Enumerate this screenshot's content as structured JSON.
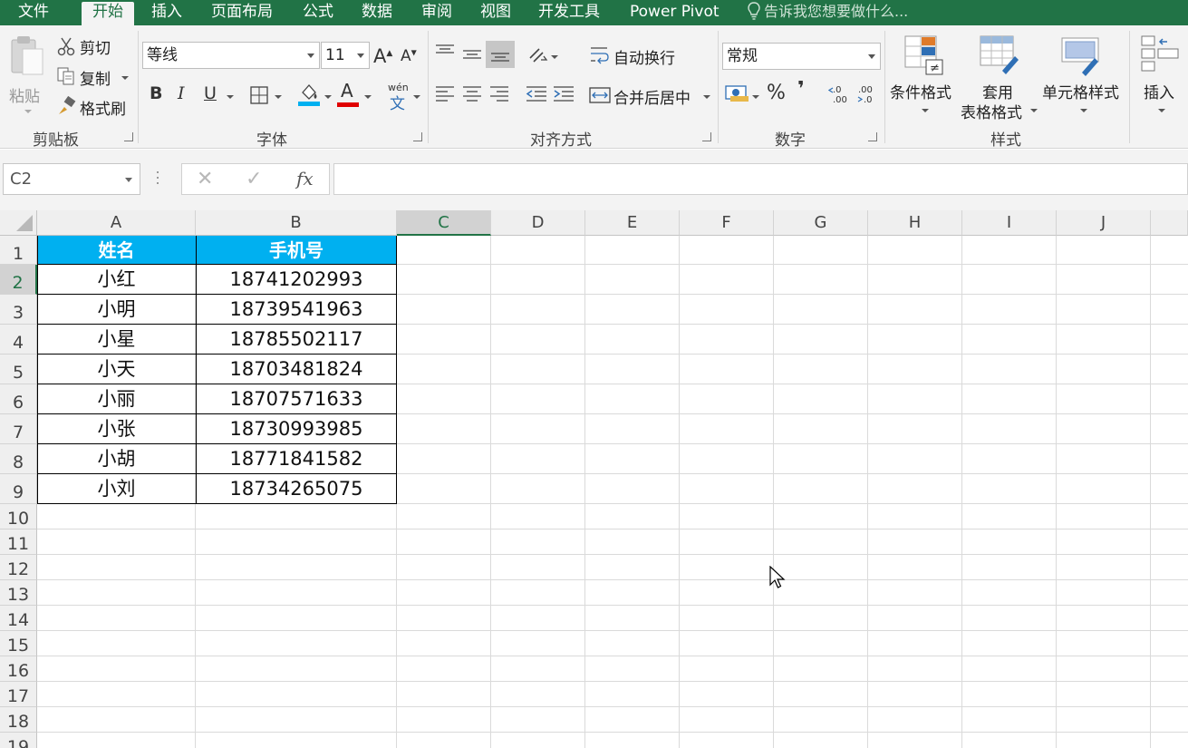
{
  "menu": {
    "tabs": [
      {
        "label": "文件"
      },
      {
        "label": "开始"
      },
      {
        "label": "插入"
      },
      {
        "label": "页面布局"
      },
      {
        "label": "公式"
      },
      {
        "label": "数据"
      },
      {
        "label": "审阅"
      },
      {
        "label": "视图"
      },
      {
        "label": "开发工具"
      },
      {
        "label": "Power Pivot"
      }
    ],
    "active_tab": "开始",
    "tell_me": "告诉我您想要做什么..."
  },
  "ribbon": {
    "clipboard": {
      "paste": "粘贴",
      "cut": "剪切",
      "copy": "复制",
      "format_painter": "格式刷",
      "group_label": "剪贴板"
    },
    "font": {
      "font_name": "等线",
      "font_size": "11",
      "bold": "B",
      "italic": "I",
      "underline": "U",
      "font_color_glyph": "A",
      "phonetic_top": "wén",
      "phonetic_bottom": "文",
      "group_label": "字体"
    },
    "alignment": {
      "wrap_text": "自动换行",
      "merge_center": "合并后居中",
      "group_label": "对齐方式"
    },
    "number": {
      "format": "常规",
      "percent": "%",
      "comma": "❜",
      "group_label": "数字"
    },
    "styles": {
      "conditional_format": "条件格式",
      "format_as_table_1": "套用",
      "format_as_table_2": "表格格式",
      "cell_styles": "单元格样式",
      "group_label": "样式"
    },
    "cells": {
      "insert": "插入"
    }
  },
  "formula_bar": {
    "name_box": "C2",
    "cancel": "✕",
    "enter": "✓",
    "fx": "fx",
    "formula": ""
  },
  "sheet": {
    "columns": [
      "A",
      "B",
      "C",
      "D",
      "E",
      "F",
      "G",
      "H",
      "I",
      "J"
    ],
    "rows": [
      "1",
      "2",
      "3",
      "4",
      "5",
      "6",
      "7",
      "8",
      "9",
      "10",
      "11",
      "12",
      "13",
      "14",
      "15",
      "16",
      "17",
      "18",
      "19"
    ],
    "table": {
      "headers": [
        "姓名",
        "手机号"
      ],
      "rows": [
        [
          "小红",
          "18741202993"
        ],
        [
          "小明",
          "18739541963"
        ],
        [
          "小星",
          "18785502117"
        ],
        [
          "小天",
          "18703481824"
        ],
        [
          "小丽",
          "18707571633"
        ],
        [
          "小张",
          "18730993985"
        ],
        [
          "小胡",
          "18771841582"
        ],
        [
          "小刘",
          "18734265075"
        ]
      ]
    },
    "header_fill_color": "#00B0F0",
    "selected_cell": "C2"
  },
  "colors": {
    "brand_green": "#217346"
  }
}
